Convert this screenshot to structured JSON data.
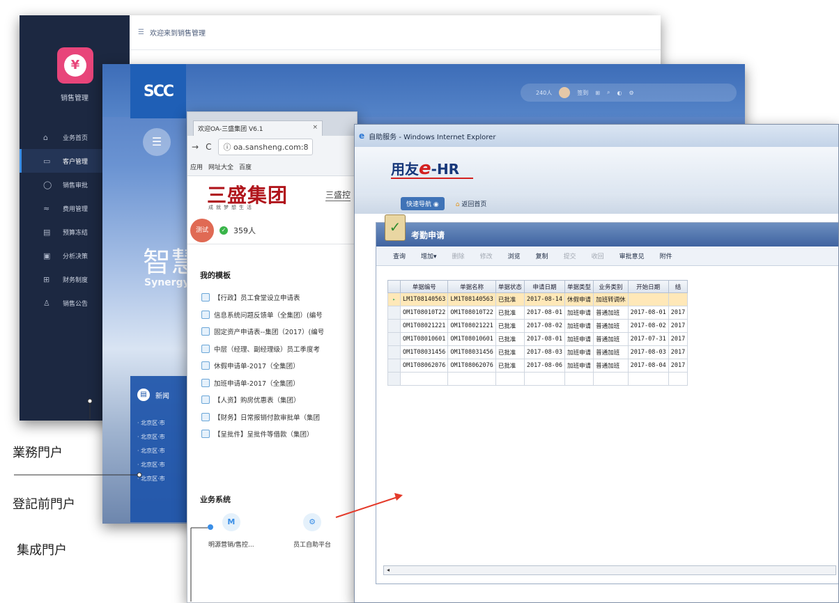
{
  "sales_portal": {
    "app_title": "销售管理",
    "breadcrumb": "欢迎来到销售管理",
    "menu": [
      {
        "label": "业务首页",
        "icon": "home-icon",
        "glyph": "⌂"
      },
      {
        "label": "客户管理",
        "icon": "customer-icon",
        "glyph": "▭"
      },
      {
        "label": "销售审批",
        "icon": "chat-icon",
        "glyph": "◯"
      },
      {
        "label": "费用管理",
        "icon": "chart-icon",
        "glyph": "≈"
      },
      {
        "label": "预算冻结",
        "icon": "document-icon",
        "glyph": "▤"
      },
      {
        "label": "分析决策",
        "icon": "calendar-icon",
        "glyph": "▣"
      },
      {
        "label": "财务制度",
        "icon": "grid-icon",
        "glyph": "⊞"
      },
      {
        "label": "销售公告",
        "icon": "user-icon",
        "glyph": "♙"
      }
    ]
  },
  "oa_portal": {
    "logo": "SCC",
    "online_count": "240人",
    "sign_in": "签到",
    "hero": "智慧",
    "hero_sub": "Synergy",
    "news_title": "新闻",
    "news_items": [
      "· 北京区·市",
      "· 北京区·市",
      "· 北京区·市",
      "· 北京区·市",
      "· 北京区·市"
    ]
  },
  "browser": {
    "tab_title": "欢迎OA-三盛集团 V6.1",
    "tab_close": "×",
    "url": "oa.sansheng.com:8",
    "bookmarks": [
      "应用",
      "网址大全",
      "百度"
    ],
    "brand": "三盛集团",
    "brand_sub": "成就梦想生活",
    "brand_link": "三盛控",
    "user_avatar": "测试",
    "online_count": "359人",
    "templates_title": "我的模板",
    "templates": [
      "【行政】员工食堂设立申请表",
      "信息系统问题反馈单（全集团）(编号",
      "固定资产申请表--集团（2017）(编号",
      "中层（经理、副经理级）员工季度考",
      "休假申请单-2017（全集团）",
      "加班申请单-2017（全集团）",
      "【人资】购房优惠表（集团）",
      "【财务】日常报销付款审批单（集团",
      "【呈批件】呈批件等借款（集团）"
    ],
    "systems_title": "业务系统",
    "systems": [
      {
        "label": "明源营销/售控...",
        "glyph": "M"
      },
      {
        "label": "员工自助平台",
        "glyph": "⚙"
      }
    ]
  },
  "ehr": {
    "window_title": "自助服务 - Windows Internet Explorer",
    "logo_prefix": "用友",
    "logo_e": "e",
    "logo_suffix": "-HR",
    "quick_nav": "快速导航",
    "back_home": "返回首页",
    "panel_title": "考勤申请",
    "toolbar": [
      {
        "label": "查询",
        "enabled": true
      },
      {
        "label": "增加▾",
        "enabled": true
      },
      {
        "label": "删除",
        "enabled": false
      },
      {
        "label": "修改",
        "enabled": false
      },
      {
        "label": "浏览",
        "enabled": true
      },
      {
        "label": "复制",
        "enabled": true
      },
      {
        "label": "提交",
        "enabled": false
      },
      {
        "label": "收回",
        "enabled": false
      },
      {
        "label": "审批意见",
        "enabled": true
      },
      {
        "label": "附件",
        "enabled": true
      }
    ],
    "columns": [
      "单据编号",
      "单据名称",
      "单据状态",
      "申请日期",
      "单据类型",
      "业务类别",
      "开始日期",
      "结"
    ],
    "rows": [
      [
        "LM1T08140563",
        "LM1T08140563",
        "已批准",
        "2017-08-14",
        "休假申请",
        "加班转调休",
        "",
        ""
      ],
      [
        "OM1T08010T22",
        "OM1T08010T22",
        "已批准",
        "2017-08-01",
        "加班申请",
        "普通加班",
        "2017-08-01",
        "2017"
      ],
      [
        "OM1T08021221",
        "OM1T08021221",
        "已批准",
        "2017-08-02",
        "加班申请",
        "普通加班",
        "2017-08-02",
        "2017"
      ],
      [
        "OM1T08010601",
        "OM1T08010601",
        "已批准",
        "2017-08-01",
        "加班申请",
        "普通加班",
        "2017-07-31",
        "2017"
      ],
      [
        "OM1T08031456",
        "OM1T08031456",
        "已批准",
        "2017-08-03",
        "加班申请",
        "普通加班",
        "2017-08-03",
        "2017"
      ],
      [
        "OM1T08062076",
        "OM1T08062076",
        "已批准",
        "2017-08-06",
        "加班申请",
        "普通加班",
        "2017-08-04",
        "2017"
      ]
    ],
    "scroll_glyph": "◂"
  },
  "labels": {
    "business_portal": "業務門户",
    "registration_portal": "登記前門户",
    "integrated_portal": "集成門户"
  }
}
